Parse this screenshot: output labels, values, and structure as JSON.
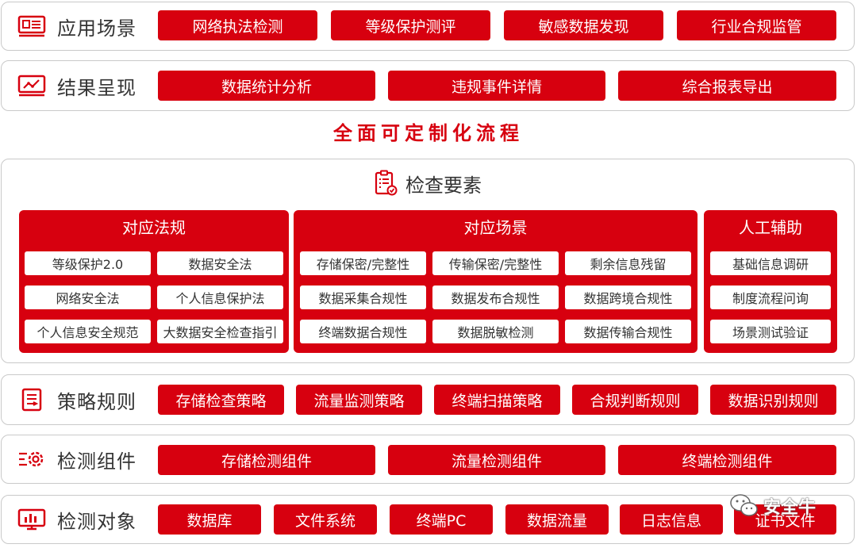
{
  "colors": {
    "accent": "#d7000f",
    "border": "#c9c9c9"
  },
  "rows": {
    "app_scenarios": {
      "label": "应用场景",
      "icon": "monitor-list-icon",
      "buttons": [
        "网络执法检测",
        "等级保护测评",
        "敏感数据发现",
        "行业合规监管"
      ]
    },
    "results": {
      "label": "结果呈现",
      "icon": "monitor-chart-icon",
      "buttons": [
        "数据统计分析",
        "违规事件详情",
        "综合报表导出"
      ]
    },
    "strategy": {
      "label": "策略规则",
      "icon": "document-list-icon",
      "buttons": [
        "存储检查策略",
        "流量监测策略",
        "终端扫描策略",
        "合规判断规则",
        "数据识别规则"
      ]
    },
    "components": {
      "label": "检测组件",
      "icon": "gear-icon",
      "buttons": [
        "存储检测组件",
        "流量检测组件",
        "终端检测组件"
      ]
    },
    "targets": {
      "label": "检测对象",
      "icon": "monitor-bar-icon",
      "buttons": [
        "数据库",
        "文件系统",
        "终端PC",
        "数据流量",
        "日志信息",
        "证书文件"
      ]
    }
  },
  "middle_title": "全面可定制化流程",
  "inspection": {
    "title": "检查要素",
    "icon": "checklist-icon",
    "groups": {
      "regulations": {
        "title": "对应法规",
        "items": [
          "等级保护2.0",
          "数据安全法",
          "网络安全法",
          "个人信息保护法",
          "个人信息安全规范",
          "大数据安全检查指引"
        ]
      },
      "scenarios": {
        "title": "对应场景",
        "items": [
          "存储保密/完整性",
          "传输保密/完整性",
          "剩余信息残留",
          "数据采集合规性",
          "数据发布合规性",
          "数据跨境合规性",
          "终端数据合规性",
          "数据脱敏检测",
          "数据传输合规性"
        ]
      },
      "manual": {
        "title": "人工辅助",
        "items": [
          "基础信息调研",
          "制度流程问询",
          "场景测试验证"
        ]
      }
    }
  },
  "watermark": {
    "text": "安全牛",
    "icon": "wechat-icon"
  }
}
